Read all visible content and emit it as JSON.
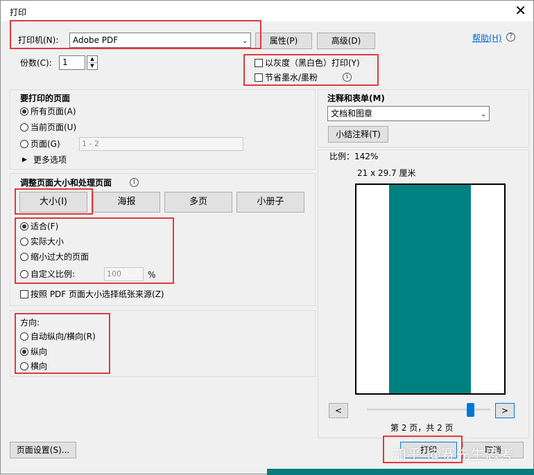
{
  "window": {
    "title": "打印",
    "close_icon": "✕"
  },
  "printer": {
    "label": "打印机(N):",
    "value": "Adobe PDF",
    "properties_button": "属性(P)",
    "advanced_button": "高级(D)"
  },
  "help": {
    "label": "帮助(H)"
  },
  "copies": {
    "label": "份数(C):",
    "value": "1"
  },
  "options": {
    "grayscale": "以灰度（黑白色）打印(Y)",
    "save_ink": "节省墨水/墨粉"
  },
  "pages_to_print": {
    "heading": "要打印的页面",
    "all": "所有页面(A)",
    "current": "当前页面(U)",
    "pages": "页面(G)",
    "pages_range_placeholder": "1 - 2",
    "more_options": "更多选项",
    "selected": "all"
  },
  "size_handling": {
    "heading": "调整页面大小和处理页面",
    "tabs": [
      "大小(I)",
      "海报",
      "多页",
      "小册子"
    ],
    "fit": "适合(F)",
    "actual": "实际大小",
    "shrink": "缩小过大的页面",
    "custom": "自定义比例:",
    "custom_value": "100",
    "percent": "%",
    "paper_source": "按照 PDF 页面大小选择纸张来源(Z)",
    "selected": "fit"
  },
  "orientation": {
    "heading": "方向:",
    "auto": "自动纵向/横向(R)",
    "portrait": "纵向",
    "landscape": "横向",
    "selected": "portrait"
  },
  "comments_forms": {
    "heading": "注释和表单(M)",
    "value": "文档和图章",
    "summarize_button": "小结注释(T)"
  },
  "preview": {
    "scale": "比例：142%",
    "paper_size": "21 x 29.7 厘米",
    "prev_button": "<",
    "next_button": ">",
    "page_status": "第 2 页，共 2 页",
    "position": 0.86,
    "content_color": "#008080"
  },
  "buttons": {
    "page_setup": "页面设置(S)...",
    "print": "打印",
    "cancel": "取消"
  },
  "watermark": "知乎 @赛先生思考",
  "colors": {
    "highlight_red": "#e0393e",
    "accent_blue": "#0078d7",
    "link_blue": "#0066cc"
  }
}
